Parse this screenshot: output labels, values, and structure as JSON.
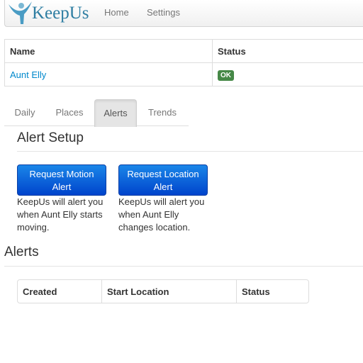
{
  "navbar": {
    "brand": "KeepUs",
    "links": [
      "Home",
      "Settings"
    ]
  },
  "status_table": {
    "headers": [
      "Name",
      "Status"
    ],
    "rows": [
      {
        "name": "Aunt Elly",
        "status": "OK"
      }
    ]
  },
  "tabs": [
    "Daily",
    "Places",
    "Alerts",
    "Trends"
  ],
  "active_tab": "Alerts",
  "alert_setup": {
    "title": "Alert Setup",
    "motion_button": [
      "Request Motion",
      "Alert"
    ],
    "motion_desc": [
      "KeepUs will alert you",
      "when Aunt Elly starts",
      "moving."
    ],
    "location_button": [
      "Request Location",
      "Alert"
    ],
    "location_desc": [
      "KeepUs will alert you",
      "when Aunt Elly",
      "changes location."
    ]
  },
  "alerts": {
    "title": "Alerts",
    "headers": [
      "Created",
      "Start Location",
      "Status"
    ]
  },
  "colors": {
    "brand": "#2f7ea2",
    "link": "#0088cc",
    "ok_badge": "#468847",
    "primary_button": "#0055dd"
  }
}
